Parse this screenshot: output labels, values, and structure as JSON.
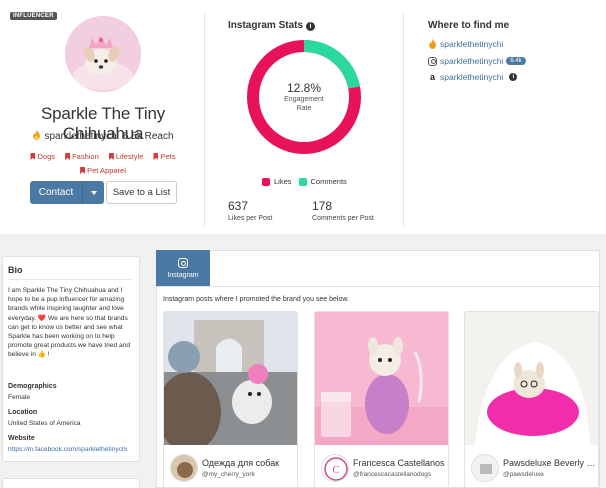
{
  "badge": "INFLUENCER",
  "profile": {
    "name": "Sparkle The Tiny Chihuahua",
    "handle": "sparklethetinychi",
    "reach": "6.5k Reach",
    "categories": [
      "Dogs",
      "Fashion",
      "Lifestyle",
      "Pets",
      "Pet Apparel"
    ],
    "contact_label": "Contact",
    "save_label": "Save to a List"
  },
  "stats": {
    "title": "Instagram Stats",
    "engagement_value": "12.8%",
    "engagement_label": "Engagement Rate",
    "engagement_fraction": 0.128,
    "legend": [
      {
        "label": "Likes",
        "color": "#e8125c"
      },
      {
        "label": "Comments",
        "color": "#2bd8a0"
      }
    ],
    "likes_value": "637",
    "likes_label": "Likes per Post",
    "comments_value": "178",
    "comments_label": "Comments per Post",
    "likes_share": 0.78
  },
  "where": {
    "title": "Where to find me",
    "items": [
      {
        "icon": "fire-icon",
        "label": "sparklethetinychi"
      },
      {
        "icon": "instagram-icon",
        "label": "sparklethetinychi",
        "badge": "6.4k"
      },
      {
        "icon": "amazon-icon",
        "label": "sparklethetinychi"
      }
    ]
  },
  "bio": {
    "title": "Bio",
    "text": "I am Sparkle The Tiny Chihuahua and I hope to be a pup influencer for amazing brands while inspiring laughter and love everyday. ❤️ We are here so that brands can get to know us better and see what Sparkle has been working on to help promote great products we have tried and believe in 👍 !",
    "demographics_label": "Demographics",
    "demographics_value": "Female",
    "location_label": "Location",
    "location_value": "United States of America",
    "website_label": "Website",
    "website_value": "https://m.facebook.com/sparklethetinychi"
  },
  "content": {
    "tab_label": "Instagram",
    "description": "Instagram posts where I promoted the brand you see below.",
    "posts": [
      {
        "brand": "Одежда для собак",
        "handle": "@my_cherry_york"
      },
      {
        "brand": "Francesca Castellanos",
        "handle": "@francescacastellanodogs"
      },
      {
        "brand": "Pawsdeluxe Beverly Hills",
        "handle": "@pawsdeluxe"
      }
    ]
  },
  "colors": {
    "accent": "#4a7aa3",
    "link": "#3f6fa0",
    "category_red": "#c0392b",
    "likes_pink": "#e8125c",
    "comments_green": "#2bd8a0"
  }
}
